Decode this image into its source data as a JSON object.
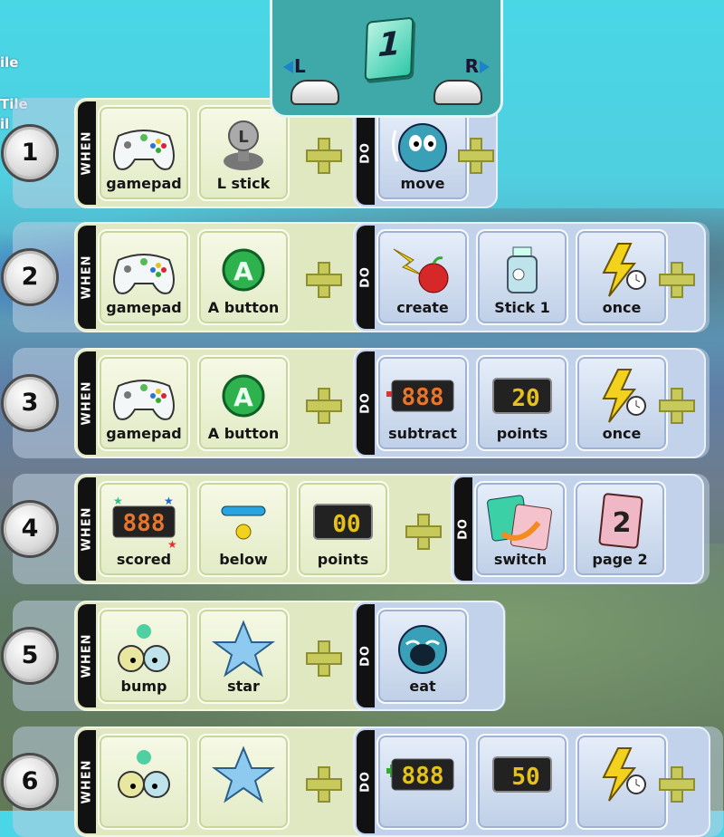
{
  "side_text": [
    "ile",
    "Tile",
    "il"
  ],
  "page_selector": {
    "page": "1",
    "left": "L",
    "right": "R"
  },
  "stripes": {
    "when": "WHEN",
    "do": "DO"
  },
  "rows": [
    {
      "num": "1",
      "when": [
        {
          "label": "gamepad",
          "icon": "gamepad-icon"
        },
        {
          "label": "L stick",
          "icon": "l-stick-icon"
        }
      ],
      "do": [
        {
          "label": "move",
          "icon": "move-icon"
        }
      ]
    },
    {
      "num": "2",
      "when": [
        {
          "label": "gamepad",
          "icon": "gamepad-icon"
        },
        {
          "label": "A button",
          "icon": "a-button-icon"
        }
      ],
      "do": [
        {
          "label": "create",
          "icon": "create-icon"
        },
        {
          "label": "Stick 1",
          "icon": "stick-character-icon"
        },
        {
          "label": "once",
          "icon": "once-icon"
        }
      ]
    },
    {
      "num": "3",
      "when": [
        {
          "label": "gamepad",
          "icon": "gamepad-icon"
        },
        {
          "label": "A button",
          "icon": "a-button-icon"
        }
      ],
      "do": [
        {
          "label": "subtract",
          "icon": "subtract-icon",
          "display": "888"
        },
        {
          "label": "points",
          "icon": "points-icon",
          "display": "20"
        },
        {
          "label": "once",
          "icon": "once-icon"
        }
      ]
    },
    {
      "num": "4",
      "when": [
        {
          "label": "scored",
          "icon": "scored-icon",
          "display": "888"
        },
        {
          "label": "below",
          "icon": "below-icon"
        },
        {
          "label": "points",
          "icon": "points-icon",
          "display": "00"
        }
      ],
      "do": [
        {
          "label": "switch",
          "icon": "switch-icon"
        },
        {
          "label": "page 2",
          "icon": "page-icon",
          "display": "2"
        }
      ]
    },
    {
      "num": "5",
      "when": [
        {
          "label": "bump",
          "icon": "bump-icon"
        },
        {
          "label": "star",
          "icon": "star-icon"
        }
      ],
      "do": [
        {
          "label": "eat",
          "icon": "eat-icon"
        }
      ]
    },
    {
      "num": "6",
      "when": [
        {
          "label": "",
          "icon": "bump-icon"
        },
        {
          "label": "",
          "icon": "star-icon"
        }
      ],
      "do": [
        {
          "label": "",
          "icon": "add-icon",
          "display": "888"
        },
        {
          "label": "",
          "icon": "points-icon",
          "display": "50"
        },
        {
          "label": "",
          "icon": "once-icon"
        }
      ]
    }
  ],
  "colors": {
    "when_panel": "#dfe8c0",
    "do_panel": "#c2d2ea",
    "plus": "#c7c95a",
    "page_panel": "#3fa8a9"
  }
}
